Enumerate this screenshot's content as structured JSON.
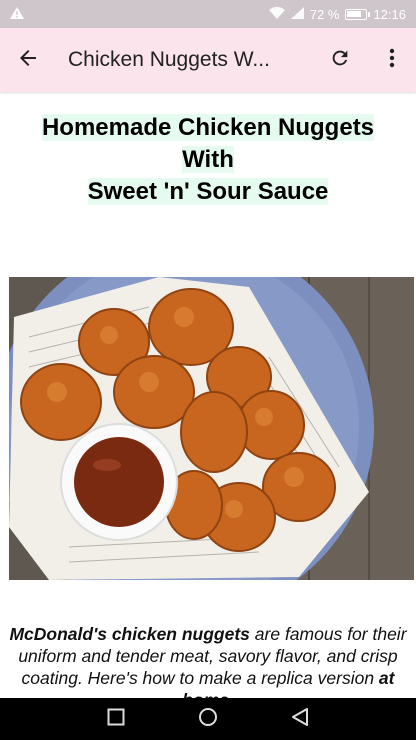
{
  "status_bar": {
    "battery_percent": "72 %",
    "time": "12:16"
  },
  "app_bar": {
    "title": "Chicken Nuggets W..."
  },
  "article": {
    "headline_line1": "Homemade Chicken Nuggets",
    "headline_line2": "With",
    "headline_line3": "Sweet 'n' Sour Sauce",
    "intro_bold1": "McDonald's chicken nuggets",
    "intro_text": " are famous for their uniform and tender meat, savory flavor, and crisp coating. Here's how to make a replica version ",
    "intro_bold2": "at home."
  },
  "colors": {
    "status_bar": "#cfc6cb",
    "app_bar": "#fbe4ec",
    "headline_highlight": "#e6fbef"
  },
  "icons": [
    "warning-icon",
    "wifi-icon",
    "signal-icon",
    "battery-icon",
    "back-arrow-icon",
    "refresh-icon",
    "more-vert-icon",
    "recents-icon",
    "home-icon",
    "back-icon"
  ]
}
